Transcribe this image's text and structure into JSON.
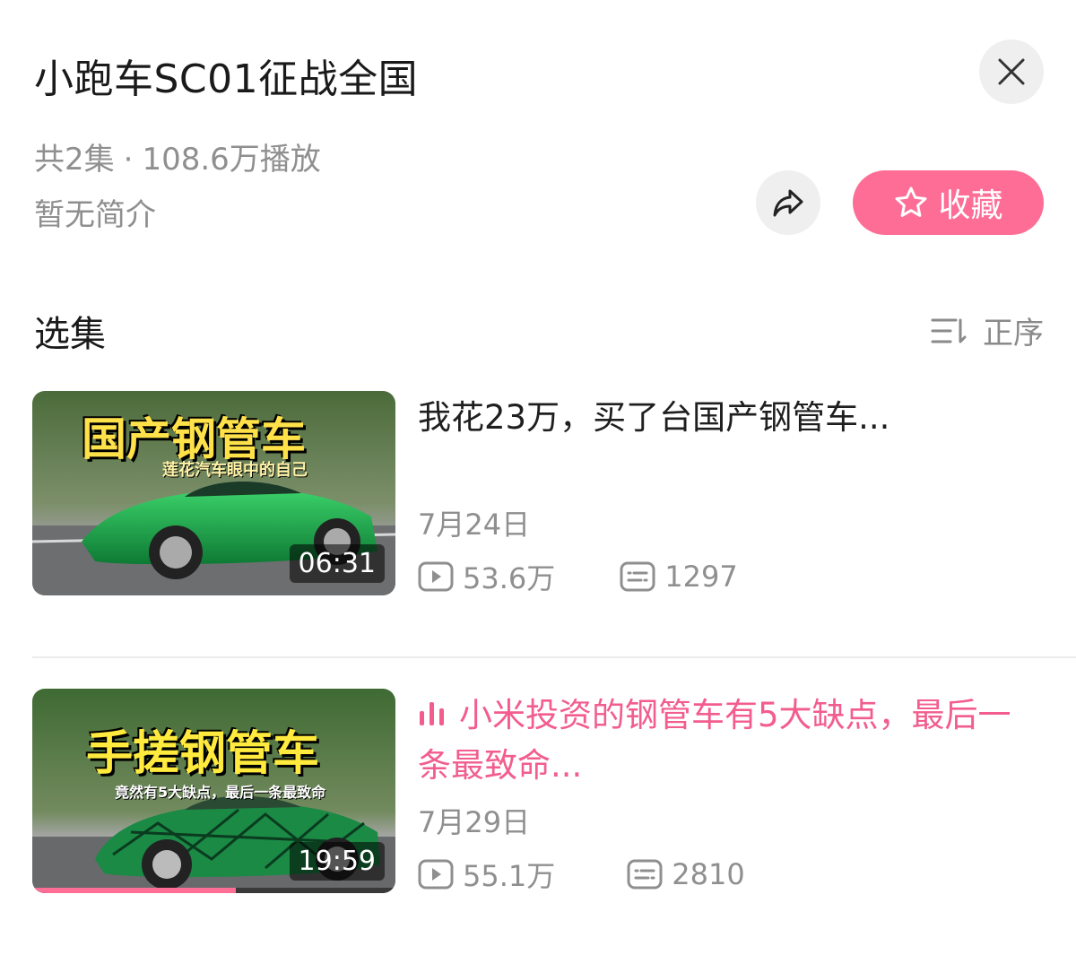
{
  "header": {
    "title": "小跑车SC01征战全国",
    "episode_count": "共2集",
    "separator": "·",
    "play_count": "108.6万播放",
    "description": "暂无简介",
    "favorite_label": "收藏"
  },
  "section": {
    "title": "选集",
    "order_label": "正序"
  },
  "episodes": [
    {
      "title": "我花23万，买了台国产钢管车...",
      "date": "7月24日",
      "duration": "06:31",
      "plays": "53.6万",
      "comments": "1297",
      "thumb_headline": "国产钢管车",
      "thumb_subline": "莲花汽车眼中的自己",
      "playing": false
    },
    {
      "title": "小米投资的钢管车有5大缺点，最后一条最致命...",
      "date": "7月29日",
      "duration": "19:59",
      "plays": "55.1万",
      "comments": "2810",
      "thumb_headline": "手搓钢管车",
      "thumb_subline": "竟然有5大缺点，最后一条最致命",
      "playing": true,
      "watch_progress": 0.56
    }
  ],
  "colors": {
    "accent": "#fe6d96",
    "playing_text": "#f25d8e",
    "secondary_text": "#8f8f8f",
    "button_bg": "#efefef"
  }
}
